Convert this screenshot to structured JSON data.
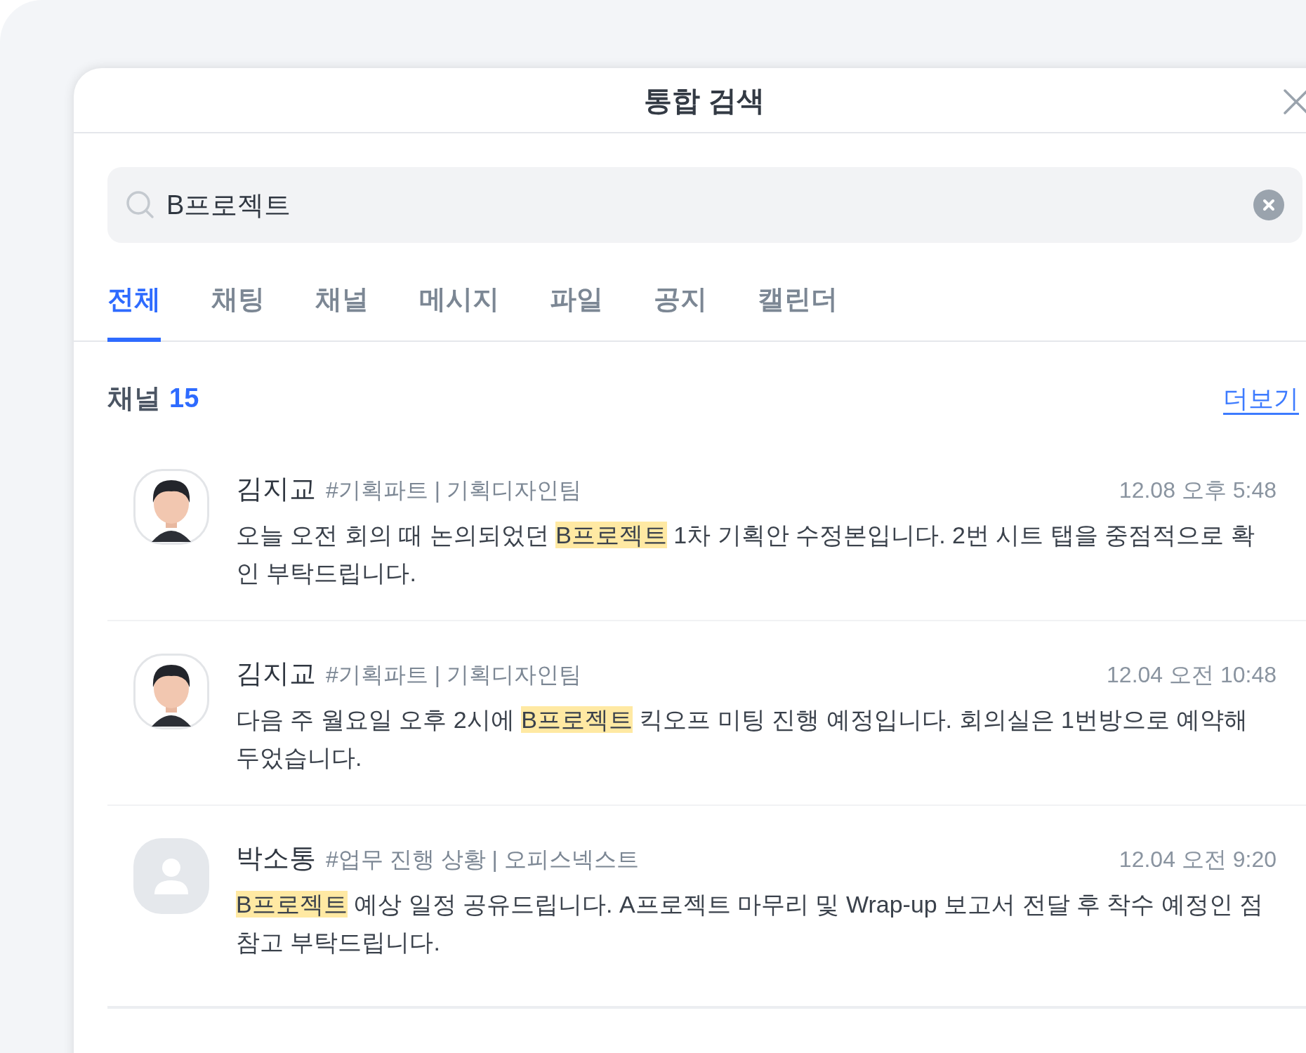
{
  "dialog": {
    "title": "통합 검색"
  },
  "search": {
    "value": "B프로젝트"
  },
  "tabs": [
    {
      "label": "전체",
      "selected": true
    },
    {
      "label": "채팅",
      "selected": false
    },
    {
      "label": "채널",
      "selected": false
    },
    {
      "label": "메시지",
      "selected": false
    },
    {
      "label": "파일",
      "selected": false
    },
    {
      "label": "공지",
      "selected": false
    },
    {
      "label": "캘린더",
      "selected": false
    }
  ],
  "section": {
    "title": "채널",
    "count": "15",
    "more_link": "더보기"
  },
  "results": [
    {
      "avatar": {
        "kind": "character"
      },
      "name": "김지교",
      "channel": "#기획파트 | 기획디자인팀",
      "time": "12.08 오후 5:48",
      "message": [
        {
          "text": "오늘 오전 회의 때 논의되었던 ",
          "highlight": false
        },
        {
          "text": "B프로젝트",
          "highlight": true
        },
        {
          "text": " 1차 기획안 수정본입니다. 2번 시트 탭을 중점적으로 확인 부탁드립니다.",
          "highlight": false
        }
      ]
    },
    {
      "avatar": {
        "kind": "character"
      },
      "name": "김지교",
      "channel": "#기획파트 | 기획디자인팀",
      "time": "12.04 오전 10:48",
      "message": [
        {
          "text": "다음 주 월요일 오후 2시에 ",
          "highlight": false
        },
        {
          "text": "B프로젝트",
          "highlight": true
        },
        {
          "text": " 킥오프 미팅 진행 예정입니다. 회의실은 1번방으로 예약해 두었습니다.",
          "highlight": false
        }
      ]
    },
    {
      "avatar": {
        "kind": "default"
      },
      "name": "박소통",
      "channel": "#업무 진행 상황 | 오피스넥스트",
      "time": "12.04 오전 9:20",
      "message": [
        {
          "text": "B프로젝트",
          "highlight": true
        },
        {
          "text": " 예상 일정 공유드립니다. A프로젝트 마무리 및 Wrap-up 보고서 전달 후 착수 예정인 점 참고 부탁드립니다.",
          "highlight": false
        }
      ]
    }
  ]
}
